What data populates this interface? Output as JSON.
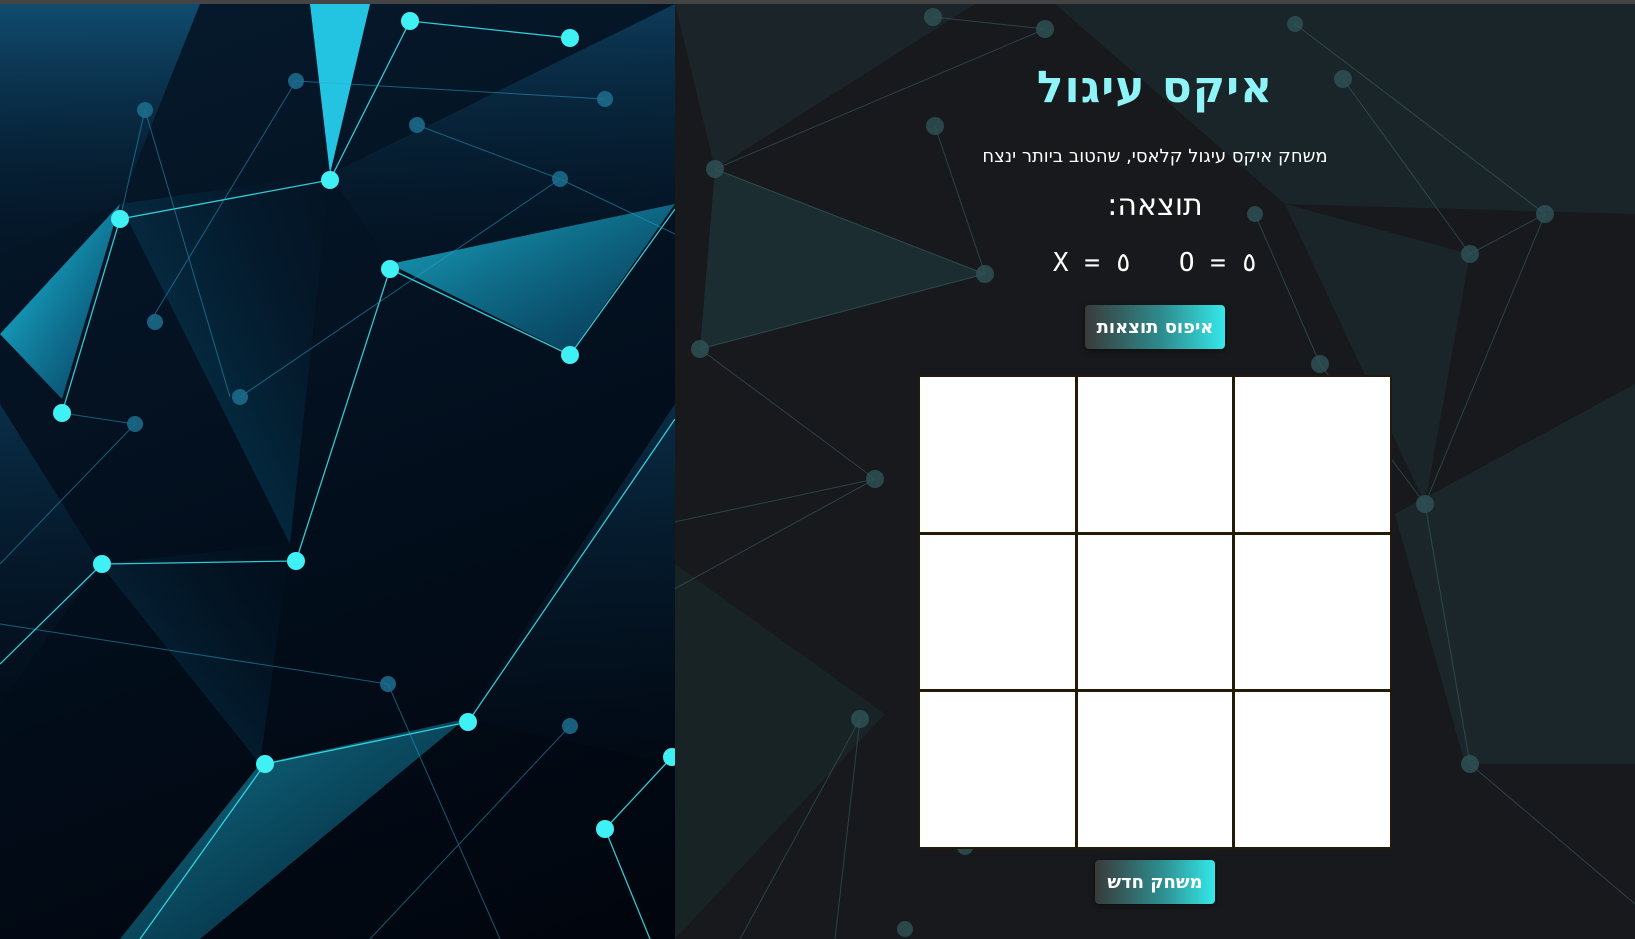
{
  "game": {
    "title": "איקס עיגול",
    "subtitle": "משחק איקס עיגול קלאסי, שהטוב ביותר ינצח",
    "score_label": "תוצאה:",
    "score_x": "X = ٥",
    "score_o": "O = ٥",
    "reset_label": "איפוס תוצאות",
    "new_game_label": "משחק חדש",
    "board": [
      "",
      "",
      "",
      "",
      "",
      "",
      "",
      "",
      ""
    ]
  },
  "colors": {
    "title": "#8ff4f7",
    "accent": "#34e8ea",
    "panel_bg": "#17191c",
    "node": "#3ff0f5"
  }
}
